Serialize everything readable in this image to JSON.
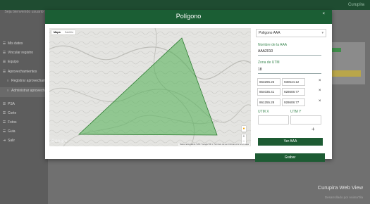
{
  "app": {
    "brand": "Curupira"
  },
  "sidebar": {
    "welcome": "Seja bienvenido usuario",
    "items": [
      {
        "icon": "list-icon",
        "glyph": "☰",
        "label": "Mis datos"
      },
      {
        "icon": "list-icon",
        "glyph": "☰",
        "label": "Vincular registro"
      },
      {
        "icon": "list-icon",
        "glyph": "☰",
        "label": "Equipo"
      },
      {
        "icon": "list-icon",
        "glyph": "☰",
        "label": "Aprovechamientos"
      },
      {
        "icon": "circle-icon",
        "glyph": "○",
        "label": "Registrar aprovechamiento"
      },
      {
        "icon": "circle-icon",
        "glyph": "○",
        "label": "Administrar aprovechamientos"
      },
      {
        "icon": "list-icon",
        "glyph": "☰",
        "label": "PSA"
      },
      {
        "icon": "list-icon",
        "glyph": "☰",
        "label": "Corte"
      },
      {
        "icon": "list-icon",
        "glyph": "☰",
        "label": "Fotos"
      },
      {
        "icon": "list-icon",
        "glyph": "☰",
        "label": "Guia"
      },
      {
        "icon": "logout-icon",
        "glyph": "⇥",
        "label": "Salir"
      }
    ]
  },
  "footer": {
    "title": "Curupira Web View",
    "subtitle": "Desarrollado por AnimaTila"
  },
  "modal": {
    "title": "Polígono",
    "close": "×",
    "map": {
      "type_options": [
        "Mapa",
        "Satélite"
      ],
      "selected_type": "Mapa",
      "logo": "Google",
      "attribution": "Datos cartográficos ©2017 Google   500 m   Términos de uso   Informar error en el mapa",
      "polygon_color": "#4caf50"
    },
    "form": {
      "select_value": "Poligono AAA",
      "name_label": "Nombre de la AAA",
      "name_value": "AAA2010",
      "zone_label": "Zona de UTM",
      "zone_value": "18",
      "coords": [
        {
          "x": "863296.25",
          "y": "930544.12"
        },
        {
          "x": "854035.41",
          "y": "928608.77"
        },
        {
          "x": "861255.28",
          "y": "928608.77"
        }
      ],
      "delete_glyph": "×",
      "utm_x_label": "UTM X",
      "utm_y_label": "UTM Y",
      "add_glyph": "+",
      "view_button": "Ver AAA",
      "save_button": "Grabar"
    }
  }
}
